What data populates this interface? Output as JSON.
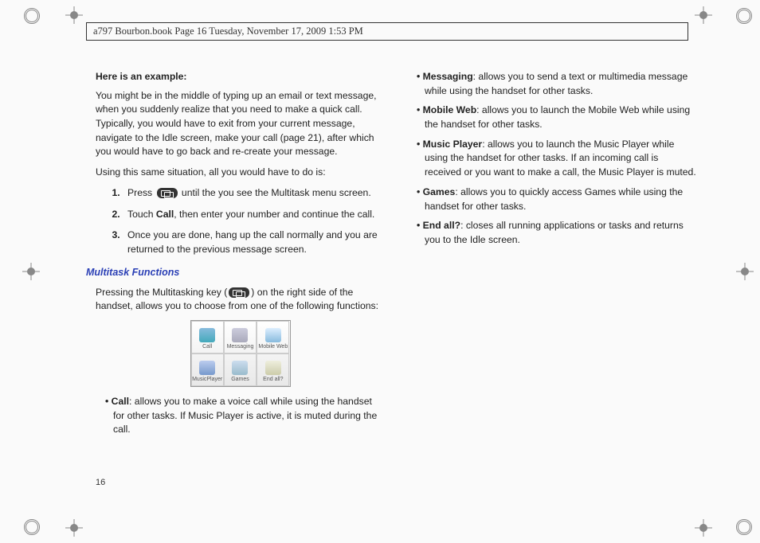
{
  "header": "a797 Bourbon.book  Page 16  Tuesday, November 17, 2009  1:53 PM",
  "pageNumber": "16",
  "col1": {
    "h1": "Here is an example:",
    "p1": "You might be in the middle of typing up an email or text message, when you suddenly realize that you need to make a quick call. Typically, you would have to exit from your current message, navigate to the Idle screen, make your call (page 21), after which you would have to go back and re-create your message.",
    "p2": "Using this same situation, all you would have to do is:",
    "step1a": "Press ",
    "step1b": " until the you see the Multitask menu screen.",
    "step2a": "Touch ",
    "step2bold": "Call",
    "step2b": ", then enter your number and continue the call.",
    "step3": "Once you are done, hang up the call normally and you are returned to the previous message screen.",
    "h2": "Multitask Functions",
    "p3a": "Pressing the Multitasking key (",
    "p3b": ") on the right side of the handset, allows you to choose from one of the following functions:",
    "menu": {
      "c1": "Call",
      "c2": "Messaging",
      "c3": "Mobile Web",
      "c4": "MusicPlayer",
      "c5": "Games",
      "c6": "End all?"
    },
    "bul1bold": "Call",
    "bul1": ": allows you to make a voice call while using the handset for other tasks. If Music Player is active, it is muted during the call."
  },
  "col2": {
    "b1bold": "Messaging",
    "b1": ": allows you to send a text or multimedia message while using the handset for other tasks.",
    "b2bold": "Mobile Web",
    "b2": ": allows you to launch the Mobile Web while using the handset for other tasks.",
    "b3bold": "Music Player",
    "b3": ": allows you to launch the Music Player while using the handset for other tasks. If an incoming call is received or you want to make a call, the Music Player is muted.",
    "b4bold": "Games",
    "b4": ": allows you to quickly access Games while using the handset for other tasks.",
    "b5bold": "End all?",
    "b5": ": closes all running applications or tasks and returns you to the Idle screen."
  }
}
